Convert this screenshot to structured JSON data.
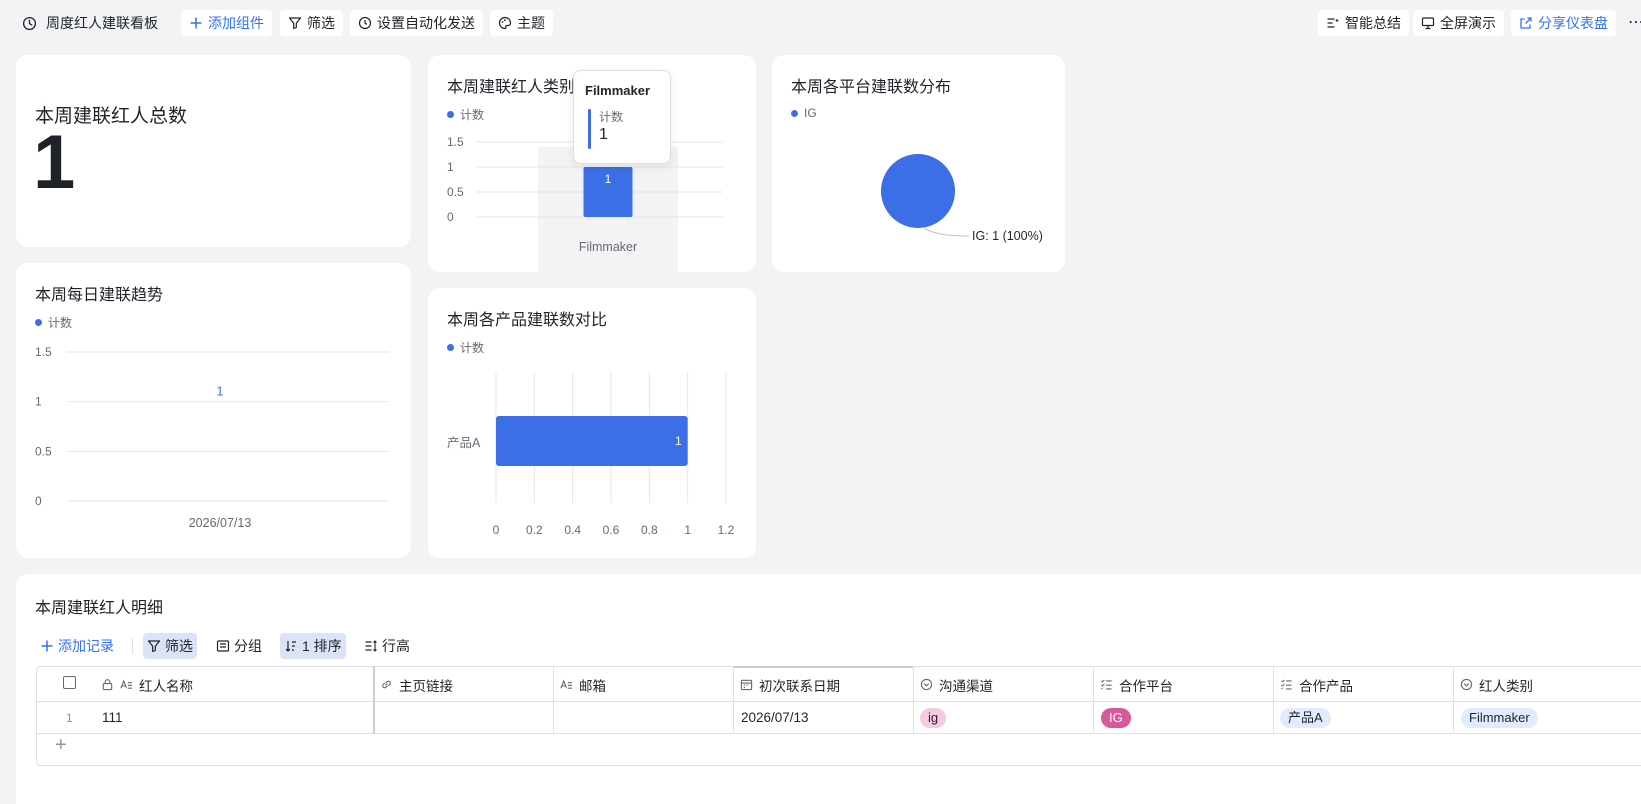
{
  "toolbar": {
    "dashboard_title": "周度红人建联看板",
    "add_widget": "添加组件",
    "filter": "筛选",
    "auto_send": "设置自动化发送",
    "theme": "主题",
    "smart_summary": "智能总结",
    "fullscreen": "全屏演示",
    "share": "分享仪表盘",
    "more": "⋯"
  },
  "colors": {
    "accent": "#3370ff",
    "series": "#3c6ee6",
    "tag_ig_light": "#f7c8e2",
    "tag_ig_dark": "#d9579b",
    "tag_blue": "#e1eaff"
  },
  "total_card": {
    "title": "本周建联红人总数",
    "value": "1"
  },
  "category_chart": {
    "title": "本周建联红人类别",
    "legend": "计数",
    "tooltip": {
      "category": "Filmmaker",
      "label": "计数",
      "value": "1"
    },
    "chart_data": {
      "type": "bar",
      "categories": [
        "Filmmaker"
      ],
      "values": [
        1
      ],
      "yticks": [
        "0",
        "0.5",
        "1",
        "1.5"
      ],
      "ylim": [
        0,
        1.5
      ],
      "data_labels": [
        "1"
      ],
      "legend_entries": [
        "计数"
      ]
    }
  },
  "platform_chart": {
    "title": "本周各平台建联数分布",
    "legend": "IG",
    "chart_data": {
      "type": "pie",
      "labels": [
        "IG"
      ],
      "values": [
        1
      ],
      "annotation": "IG: 1 (100%)",
      "legend_entries": [
        "IG"
      ]
    }
  },
  "daily_chart": {
    "title": "本周每日建联趋势",
    "legend": "计数",
    "chart_data": {
      "type": "line",
      "x": [
        "2026/07/13"
      ],
      "values": [
        1
      ],
      "yticks": [
        "0",
        "0.5",
        "1",
        "1.5"
      ],
      "ylim": [
        0,
        1.5
      ],
      "data_labels": [
        "1"
      ],
      "legend_entries": [
        "计数"
      ]
    }
  },
  "product_chart": {
    "title": "本周各产品建联数对比",
    "legend": "计数",
    "chart_data": {
      "type": "bar",
      "orientation": "horizontal",
      "categories": [
        "产品A"
      ],
      "values": [
        1
      ],
      "xticks": [
        "0",
        "0.2",
        "0.4",
        "0.6",
        "0.8",
        "1",
        "1.2"
      ],
      "xlim": [
        0,
        1.2
      ],
      "data_labels": [
        "1"
      ],
      "legend_entries": [
        "计数"
      ]
    }
  },
  "table": {
    "title": "本周建联红人明细",
    "tools": {
      "add_record": "添加记录",
      "filter": "筛选",
      "group": "分组",
      "sort": "1 排序",
      "row_height": "行高"
    },
    "columns": [
      "红人名称",
      "主页链接",
      "邮箱",
      "初次联系日期",
      "沟通渠道",
      "合作平台",
      "合作产品",
      "红人类别"
    ],
    "rows": [
      {
        "index": "1",
        "name": "111",
        "link": "",
        "email": "",
        "date": "2026/07/13",
        "channel": "ig",
        "platform": "IG",
        "product": "产品A",
        "category": "Filmmaker"
      }
    ],
    "add_row": "+"
  }
}
